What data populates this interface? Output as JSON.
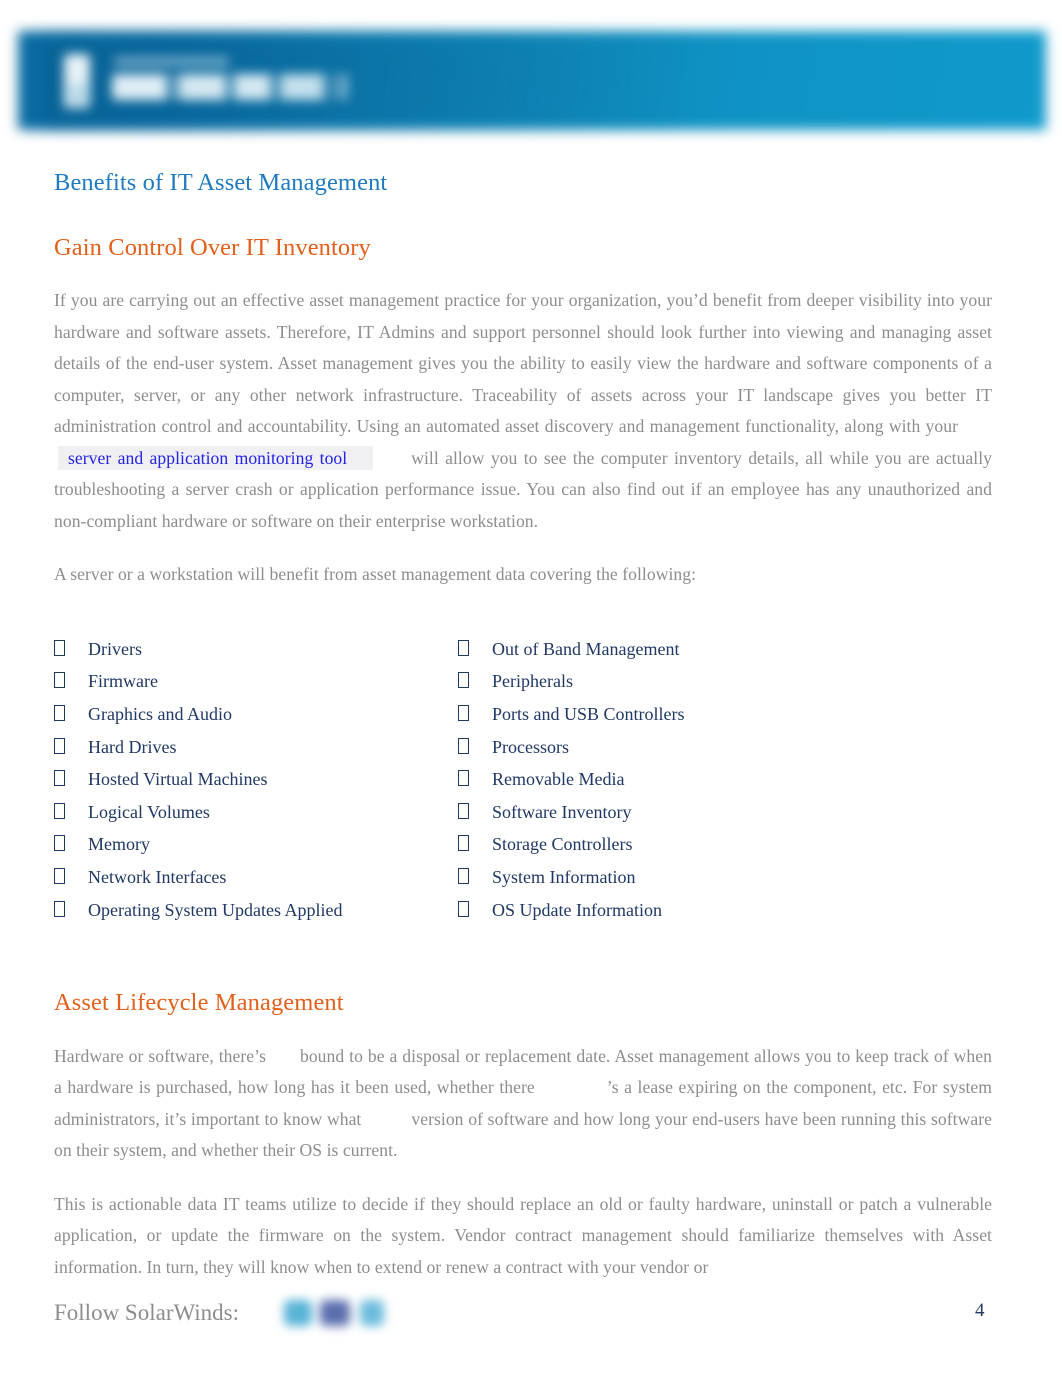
{
  "document": {
    "page_number": "4"
  },
  "header": {
    "logo_name": "solarwinds-logo",
    "banner_color_left": "#0a6ca4",
    "banner_color_right": "#0f9acb"
  },
  "main": {
    "section_title": "Benefits of IT Asset Management",
    "section_title_color": "#1f7ac0",
    "subsection_one": {
      "title": "Gain Control Over IT Inventory",
      "title_color": "#e2601a",
      "paragraph_1_part_a": "If you are carrying out an effective asset management practice for your organization, you’d benefit from deeper visibility into your hardware and software assets. Therefore, IT Admins and support personnel should look further into viewing and managing asset details of the end-user system. Asset management gives you the ability to easily view the hardware and software components of a computer, server, or any other network infrastructure. Traceability of assets across your IT landscape gives you better IT administration control and accountability. Using an automated asset discovery and management functionality, along with your",
      "link_text": "server and application monitoring tool",
      "link_color": "#2323e6",
      "paragraph_1_part_b": "will allow you to see the computer inventory details, all while you are actually troubleshooting a server crash or application performance issue. You can also find out if an employee has any unauthorized and non-compliant hardware or software on their enterprise workstation.",
      "paragraph_2": "A server or a workstation will benefit from asset management data covering the following:"
    },
    "bullet_lists": {
      "bullet_glyph": "tofu-box-icon",
      "text_color": "#1f3864",
      "left_column": [
        "Drivers",
        "Firmware",
        "Graphics and Audio",
        "Hard Drives",
        "Hosted Virtual Machines",
        "Logical Volumes",
        "Memory",
        "Network Interfaces",
        "Operating System Updates Applied"
      ],
      "right_column": [
        "Out of Band Management",
        "Peripherals",
        "Ports and USB Controllers",
        "Processors",
        "Removable Media",
        "Software Inventory",
        "Storage Controllers",
        "System Information",
        "OS Update Information"
      ]
    },
    "subsection_two": {
      "title": "Asset Lifecycle Management",
      "title_color": "#e2601a",
      "paragraph_1_a": "Hardware or software, there’s",
      "paragraph_1_b": "bound to be a disposal or replacement date. Asset management allows you to keep track of when a hardware is purchased, how long has it been used, whether there",
      "paragraph_1_c": "’s a lease expiring on the component, etc. For system administrators, it’s important to know what",
      "paragraph_1_d": "version of software and how long your end-users have been running this software on their system, and whether their OS is current.",
      "paragraph_2": "This is actionable data IT teams utilize to decide if they should replace an old or faulty hardware, uninstall or patch a vulnerable application, or update the firmware on the system. Vendor contract management should familiarize themselves with Asset information. In turn, they will know when to extend or renew a contract with your vendor or"
    }
  },
  "footer": {
    "follow_label": "Follow SolarWinds:",
    "social_icons": [
      "twitter-icon",
      "facebook-icon",
      "linkedin-icon"
    ]
  }
}
